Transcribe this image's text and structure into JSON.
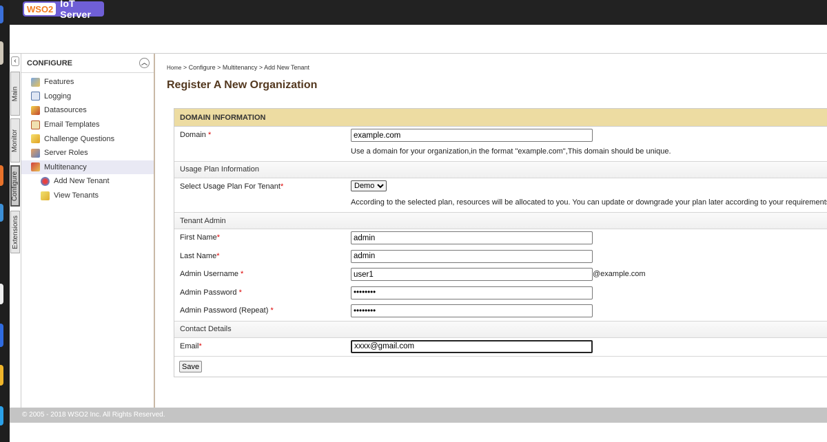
{
  "header": {
    "logo_wso2": "WSO2",
    "logo_product": "IoT Server",
    "brand_color": "#6f5fd6",
    "wso2_color": "#f47b20"
  },
  "vertical_tabs": [
    "Main",
    "Monitor",
    "Configure",
    "Extensions"
  ],
  "active_tab": "Configure",
  "sidebar": {
    "title": "CONFIGURE",
    "items": [
      {
        "label": "Features",
        "icon": "features-icon"
      },
      {
        "label": "Logging",
        "icon": "logging-icon"
      },
      {
        "label": "Datasources",
        "icon": "datasources-icon"
      },
      {
        "label": "Email Templates",
        "icon": "email-templates-icon"
      },
      {
        "label": "Challenge Questions",
        "icon": "challenge-questions-icon"
      },
      {
        "label": "Server Roles",
        "icon": "server-roles-icon"
      },
      {
        "label": "Multitenancy",
        "icon": "multitenancy-icon"
      },
      {
        "label": "Add New Tenant",
        "icon": "add-tenant-icon"
      },
      {
        "label": "View Tenants",
        "icon": "view-tenants-icon"
      }
    ]
  },
  "breadcrumb": {
    "home": "Home",
    "rest": " > Configure > Multitenancy > Add New Tenant"
  },
  "page_title": "Register A New Organization",
  "form": {
    "domain_section": "DOMAIN INFORMATION",
    "domain_label": "Domain ",
    "domain_value": "example.com",
    "domain_help": "Use a domain for your organization,in the format \"example.com\",This domain should be unique.",
    "usage_section": "Usage Plan Information",
    "plan_label": "Select Usage Plan For Tenant",
    "plan_value": "Demo",
    "plan_help": "According to the selected plan, resources will be allocated to you. You can update or downgrade your plan later according to your requirements.",
    "admin_section": "Tenant Admin",
    "first_name_label": "First Name",
    "first_name_value": "admin",
    "last_name_label": "Last Name",
    "last_name_value": "admin",
    "username_label": "Admin Username ",
    "username_value": "user1",
    "username_suffix": "@example.com",
    "password_label": "Admin Password ",
    "password_value": "********",
    "password_repeat_label": "Admin Password (Repeat) ",
    "password_repeat_value": "********",
    "contact_section": "Contact Details",
    "email_label": "Email",
    "email_value": "xxxx@gmail.com",
    "required_mark": "*",
    "save_label": "Save"
  },
  "footer": "© 2005 - 2018 WSO2 Inc. All Rights Reserved.",
  "colors": {
    "section_header": "#eddca2",
    "title": "#53381f",
    "footer": "#c4c4c4"
  }
}
